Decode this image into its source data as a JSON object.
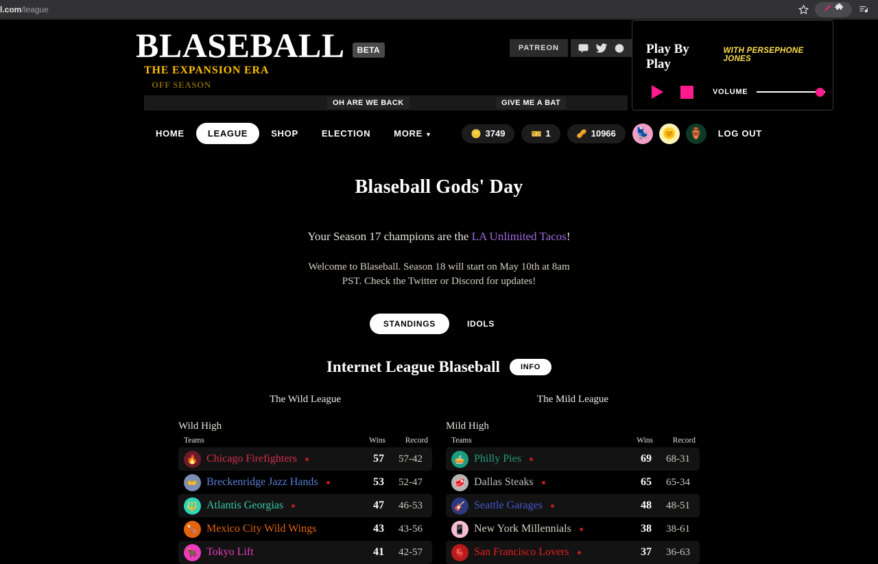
{
  "browser": {
    "url_domain": "all.com",
    "url_path": "/league",
    "icons": [
      "star-icon",
      "pen-extension-icon",
      "puzzle-extension-icon",
      "reading-list-icon"
    ]
  },
  "header": {
    "logo_title": "BLASEBALL",
    "beta_badge": "BETA",
    "era": "THE EXPANSION ERA",
    "phase": "OFF SEASON",
    "patreon": "PATREON",
    "socials": [
      "discord-icon",
      "twitter-icon",
      "github-icon"
    ]
  },
  "ticker": {
    "items": [
      "OH ARE WE BACK",
      "GIVE ME A BAT"
    ]
  },
  "nav": {
    "links": [
      {
        "label": "HOME",
        "active": false
      },
      {
        "label": "LEAGUE",
        "active": true
      },
      {
        "label": "SHOP",
        "active": false
      },
      {
        "label": "ELECTION",
        "active": false
      },
      {
        "label": "MORE",
        "active": false,
        "caret": true
      }
    ],
    "currencies": [
      {
        "icon": "coin-icon",
        "glyph": "🪙",
        "value": "3749"
      },
      {
        "icon": "ticket-icon",
        "glyph": "🎫",
        "value": "1"
      },
      {
        "icon": "peanut-icon",
        "glyph": "🥜",
        "value": "10966"
      }
    ],
    "avatars": [
      {
        "name": "stadium-seat-avatar",
        "glyph": "💺",
        "bg": "#f0a0c8"
      },
      {
        "name": "sun-avatar",
        "glyph": "🌞",
        "bg": "#fbf5b4"
      },
      {
        "name": "idol-avatar",
        "glyph": "🏺",
        "bg": "#0c3a26"
      }
    ],
    "logout": "LOG OUT"
  },
  "play_by_play": {
    "title": "Play By Play",
    "subtitle": "WITH PERSEPHONE JONES",
    "play_label": "play-button",
    "stop_label": "stop-button",
    "volume_label": "VOLUME",
    "volume_value": "100",
    "accent": "#ff1b8d"
  },
  "main": {
    "gods_day_title": "Blaseball Gods' Day",
    "champions_prefix": "Your Season 17 champions are the ",
    "champions_team": "LA Unlimited Tacos",
    "champions_suffix": "!",
    "welcome": "Welcome to Blaseball. Season 18 will start on May 10th at 8am PST. Check the Twitter or Discord for updates!",
    "subtabs": [
      {
        "label": "STANDINGS",
        "active": true
      },
      {
        "label": "IDOLS",
        "active": false
      }
    ],
    "ilb_title": "Internet League Blaseball",
    "info_pill": "INFO"
  },
  "standings": {
    "columns": {
      "teams": "Teams",
      "wins": "Wins",
      "record": "Record"
    },
    "leagues": [
      {
        "name": "The Wild League",
        "divisions": [
          {
            "name": "Wild High",
            "teams": [
              {
                "name": "Chicago Firefighters",
                "glyph": "🔥",
                "badge_bg": "#6b1a2b",
                "color": "#d3304a",
                "wins": "57",
                "record": "57-42",
                "dot": true
              },
              {
                "name": "Breckenridge Jazz Hands",
                "glyph": "👐",
                "badge_bg": "#7c8fb5",
                "color": "#5a7fd6",
                "wins": "53",
                "record": "52-47",
                "dot": true
              },
              {
                "name": "Atlantis Georgias",
                "glyph": "🔱",
                "badge_bg": "#2fd7b8",
                "color": "#36c9a5",
                "wins": "47",
                "record": "46-53",
                "dot": true
              },
              {
                "name": "Mexico City Wild Wings",
                "glyph": "🍗",
                "badge_bg": "#e2650d",
                "color": "#e2650d",
                "wins": "43",
                "record": "43-56",
                "dot": false
              },
              {
                "name": "Tokyo Lift",
                "glyph": "🐂",
                "badge_bg": "#ee3bbd",
                "color": "#ee3bbd",
                "wins": "41",
                "record": "42-57",
                "dot": false
              }
            ]
          }
        ]
      },
      {
        "name": "The Mild League",
        "divisions": [
          {
            "name": "Mild High",
            "teams": [
              {
                "name": "Philly Pies",
                "glyph": "🥧",
                "badge_bg": "#1b9e7f",
                "color": "#1f9f7a",
                "wins": "69",
                "record": "68-31",
                "dot": true
              },
              {
                "name": "Dallas Steaks",
                "glyph": "🥩",
                "badge_bg": "#b4b4b4",
                "color": "#c4c0ba",
                "wins": "65",
                "record": "65-34",
                "dot": true
              },
              {
                "name": "Seattle Garages",
                "glyph": "🎸",
                "badge_bg": "#2b3a7e",
                "color": "#4656d4",
                "wins": "48",
                "record": "48-51",
                "dot": true
              },
              {
                "name": "New York Millennials",
                "glyph": "📱",
                "badge_bg": "#f6bcd2",
                "color": "#d8d2c6",
                "wins": "38",
                "record": "38-61",
                "dot": true
              },
              {
                "name": "San Francisco Lovers",
                "glyph": "🫀",
                "badge_bg": "#b81b1b",
                "color": "#e81e1e",
                "wins": "37",
                "record": "36-63",
                "dot": true
              }
            ]
          }
        ]
      }
    ]
  }
}
